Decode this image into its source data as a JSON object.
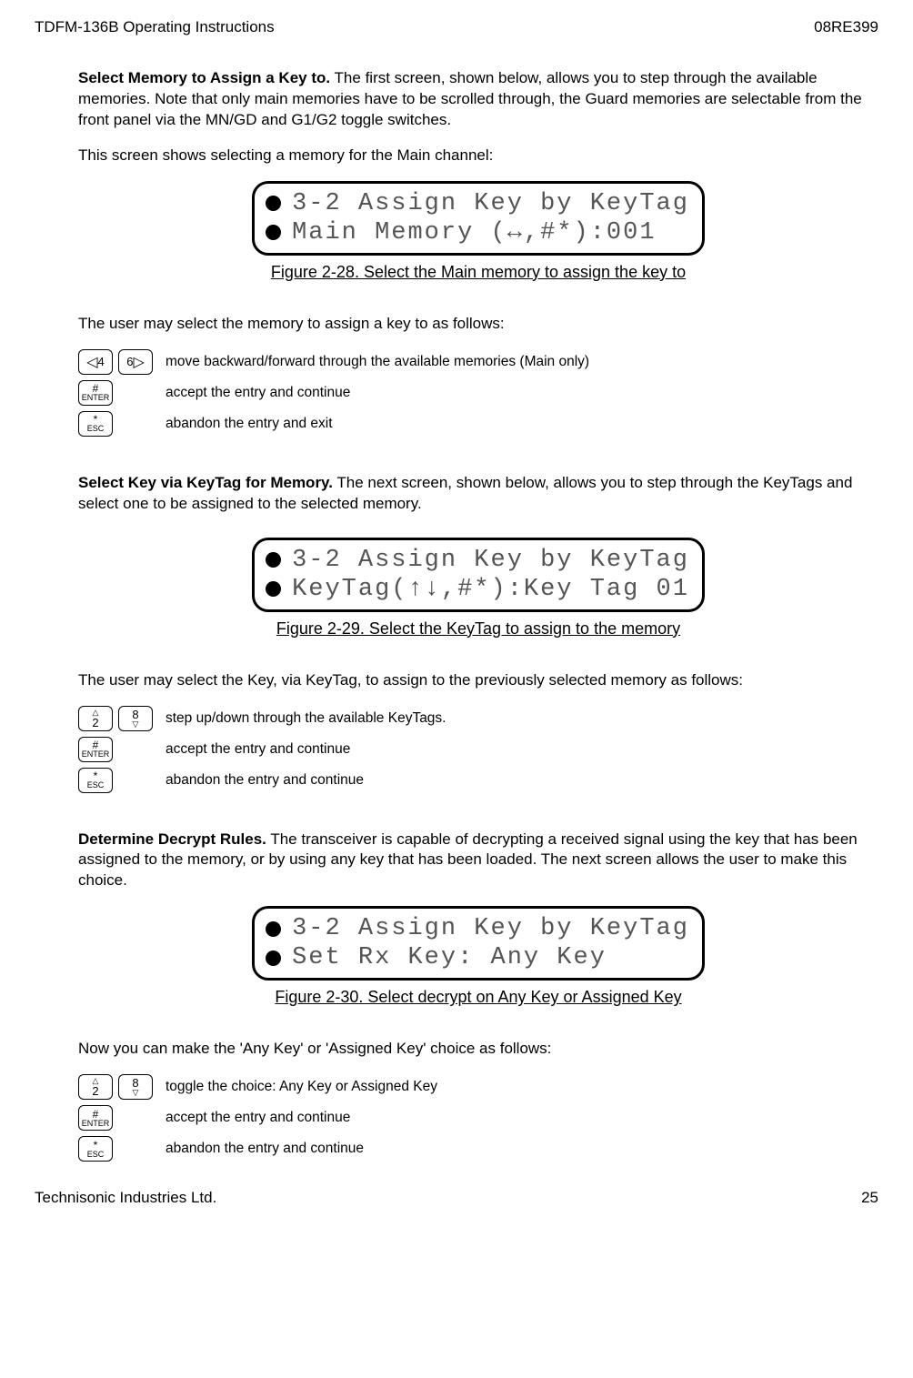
{
  "header": {
    "left": "TDFM-136B Operating Instructions",
    "right": "08RE399"
  },
  "sections": [
    {
      "title": "Select Memory to Assign a Key to.",
      "body": "The first screen, shown below, allows you to step through the available memories. Note that only main memories have to be scrolled through, the Guard memories are selectable from the front panel via the MN/GD and G1/G2 toggle switches.",
      "intro2": "This screen shows selecting a memory for the Main channel:",
      "lcd": {
        "line1": "3-2 Assign Key by KeyTag",
        "line2": "Main Memory (↔,#*):001"
      },
      "figure": "Figure 2-28. Select the Main memory to assign the key to",
      "prompt": "The user may select the memory to assign a key to as follows:",
      "keys": [
        {
          "icons": [
            "◁4",
            "6▷"
          ],
          "desc": "move backward/forward through the available memories (Main only)"
        },
        {
          "icons": [
            "#ENTER"
          ],
          "desc": "accept the entry and continue"
        },
        {
          "icons": [
            "*ESC"
          ],
          "desc": "abandon the entry and exit"
        }
      ]
    },
    {
      "title": "Select Key via KeyTag for Memory.",
      "body": "The next screen, shown below, allows you to step through the KeyTags and select one to be assigned to the selected memory.",
      "lcd": {
        "line1": "3-2 Assign Key by KeyTag",
        "line2": "KeyTag(↑↓,#*):Key Tag 01"
      },
      "figure": "Figure 2-29. Select the KeyTag to assign to the memory",
      "prompt": "The user may select the Key, via KeyTag, to assign to the previously selected memory as follows:",
      "keys": [
        {
          "icons": [
            "2△",
            "8▽"
          ],
          "desc": "step up/down through the available KeyTags."
        },
        {
          "icons": [
            "#ENTER"
          ],
          "desc": "accept the entry and continue"
        },
        {
          "icons": [
            "*ESC"
          ],
          "desc": "abandon the entry and continue"
        }
      ]
    },
    {
      "title": "Determine Decrypt Rules.",
      "body": "The transceiver is capable of decrypting a received signal using the key that has been assigned to the memory, or by using any key that has been loaded. The next screen allows the user to make this choice.",
      "lcd": {
        "line1": "3-2 Assign Key by KeyTag",
        "line2": "Set Rx Key: Any Key"
      },
      "figure": "Figure 2-30. Select decrypt on Any Key or Assigned Key",
      "prompt": "Now you can make the 'Any Key' or 'Assigned Key' choice as follows:",
      "keys": [
        {
          "icons": [
            "2△",
            "8▽"
          ],
          "desc": "toggle the choice: Any Key or Assigned Key"
        },
        {
          "icons": [
            "#ENTER"
          ],
          "desc": "accept the entry and continue"
        },
        {
          "icons": [
            "*ESC"
          ],
          "desc": "abandon the entry and continue"
        }
      ]
    }
  ],
  "keylabels": {
    "k4": "4",
    "k6": "6",
    "k2": "2",
    "k8": "8",
    "hash": "#",
    "enter": "ENTER",
    "star": "*",
    "esc": "ESC"
  },
  "footer": {
    "left": "Technisonic Industries Ltd.",
    "right": "25"
  }
}
